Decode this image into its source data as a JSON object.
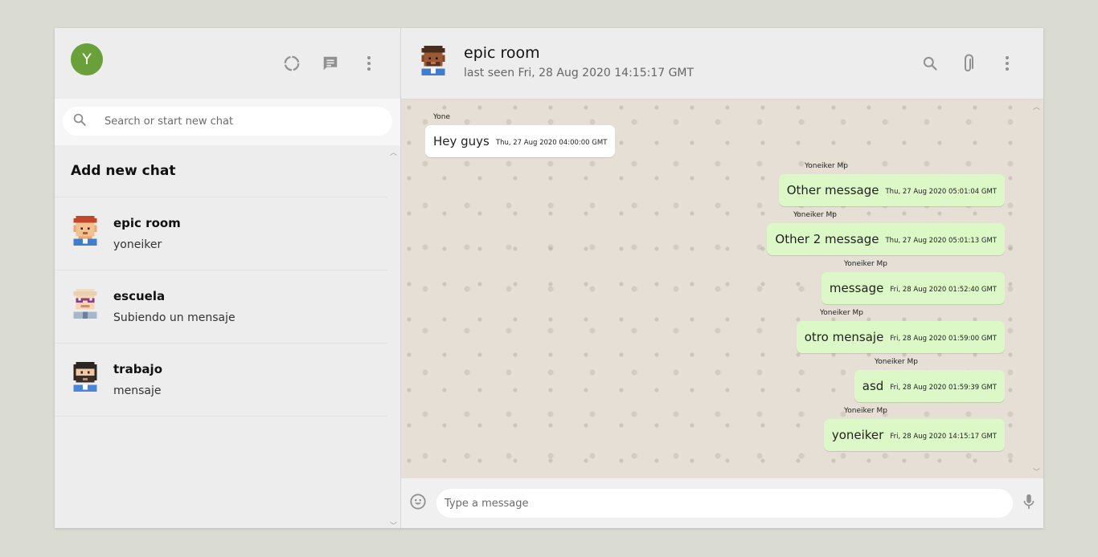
{
  "colors": {
    "accent": "#6aa03a",
    "incoming_bubble": "#ffffff",
    "outgoing_bubble": "#dcf8c6",
    "wallpaper": "#e6dfd6",
    "icon_gray": "#919191"
  },
  "sidebar": {
    "user_avatar_letter": "Y",
    "icons": [
      "status-icon",
      "new-chat-icon",
      "menu-icon"
    ],
    "search": {
      "placeholder": "Search or start new chat",
      "value": ""
    },
    "add_new_chat": "Add new chat",
    "chats": [
      {
        "name": "epic room",
        "last": "yoneiker",
        "avatar": "ginger-man-avatar"
      },
      {
        "name": "escuela",
        "last": "Subiendo un mensaje",
        "avatar": "glasses-man-avatar"
      },
      {
        "name": "trabajo",
        "last": "mensaje",
        "avatar": "bearded-man-avatar"
      }
    ]
  },
  "chat": {
    "title": "epic room",
    "subtitle": "last seen Fri, 28 Aug 2020 14:15:17 GMT",
    "header_icons": [
      "search-icon",
      "attach-icon",
      "menu-icon"
    ],
    "messages": [
      {
        "sender": "Yone",
        "text": "Hey guys",
        "time": "Thu, 27 Aug 2020 04:00:00 GMT",
        "dir": "in"
      },
      {
        "sender": "Yoneiker Mp",
        "text": "Other message",
        "time": "Thu, 27 Aug 2020 05:01:04 GMT",
        "dir": "out"
      },
      {
        "sender": "Yoneiker Mp",
        "text": "Other 2 message",
        "time": "Thu, 27 Aug 2020 05:01:13 GMT",
        "dir": "out"
      },
      {
        "sender": "Yoneiker Mp",
        "text": "message",
        "time": "Fri, 28 Aug 2020 01:52:40 GMT",
        "dir": "out"
      },
      {
        "sender": "Yoneiker Mp",
        "text": "otro mensaje",
        "time": "Fri, 28 Aug 2020 01:59:00 GMT",
        "dir": "out"
      },
      {
        "sender": "Yoneiker Mp",
        "text": "asd",
        "time": "Fri, 28 Aug 2020 01:59:39 GMT",
        "dir": "out"
      },
      {
        "sender": "Yoneiker Mp",
        "text": "yoneiker",
        "time": "Fri, 28 Aug 2020 14:15:17 GMT",
        "dir": "out"
      }
    ],
    "composer": {
      "placeholder": "Type a message",
      "value": ""
    }
  }
}
